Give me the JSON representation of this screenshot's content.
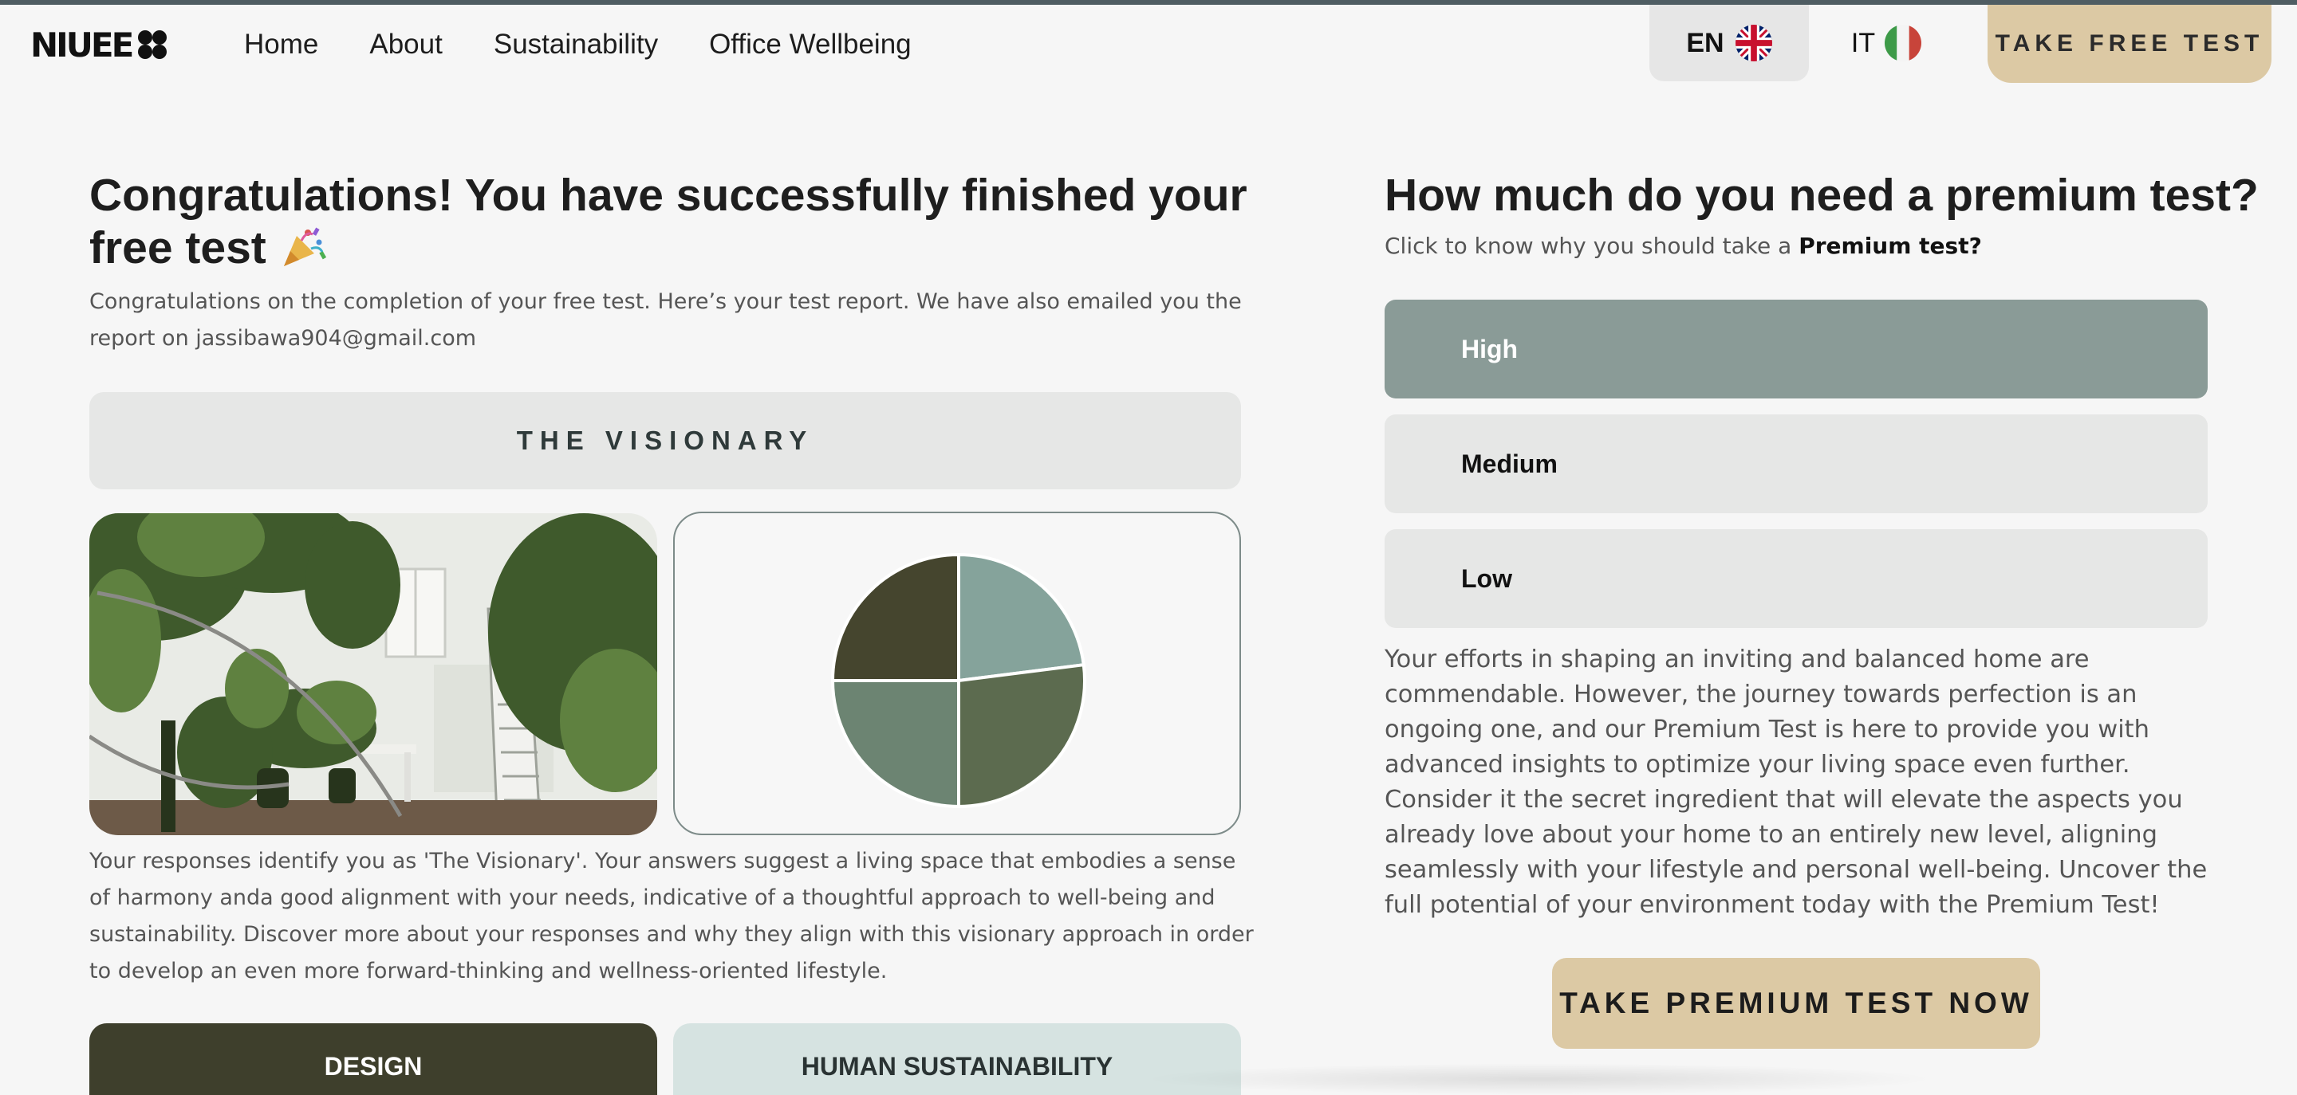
{
  "nav": {
    "logo": "NIUEE",
    "links": [
      "Home",
      "About",
      "Sustainability",
      "Office Wellbeing"
    ],
    "lang_en": "EN",
    "lang_it": "IT",
    "cta": "TAKE FREE TEST"
  },
  "result": {
    "title": "Congratulations! You have successfully finished your free test",
    "intro": "Congratulations on the completion of your free test. Here’s your test report. We have also emailed you the report on jassibawa904@gmail.com",
    "type": "THE VISIONARY",
    "description": "Your responses identify you as 'The Visionary'. Your answers suggest a living space that embodies a sense of harmony anda good alignment with your needs, indicative of a thoughtful approach to well-being and sustainability. Discover more about your responses and why they align with this visionary approach in order to develop an even more forward-thinking and wellness-oriented lifestyle.",
    "categories": [
      "DESIGN",
      "HUMAN SUSTAINABILITY"
    ]
  },
  "chart_data": {
    "type": "pie",
    "values": [
      0.23,
      0.27,
      0.25,
      0.25
    ],
    "colors": [
      "#85a39b",
      "#5c6b4f",
      "#6c8472",
      "#45452e"
    ]
  },
  "premium": {
    "title": "How much do you need a premium test?",
    "subtitle_prefix": "Click to know why you should take a ",
    "subtitle_bold": "Premium test?",
    "options": [
      "High",
      "Medium",
      "Low"
    ],
    "selected": "High",
    "text": "Your efforts in shaping an inviting and balanced home are commendable. However, the journey towards perfection is an ongoing one, and our Premium Test is here to provide you with advanced insights to optimize your living space even further. Consider it the secret ingredient that will elevate the aspects you already love about your home to an entirely new level, aligning seamlessly with your lifestyle and personal well-being. Uncover the full potential of your environment today with the Premium Test!",
    "cta": "TAKE PREMIUM TEST NOW"
  },
  "colors": {
    "accent": "#dcc9a4",
    "selected_option": "#8a9b97",
    "dark_olive": "#3e3f2c"
  }
}
